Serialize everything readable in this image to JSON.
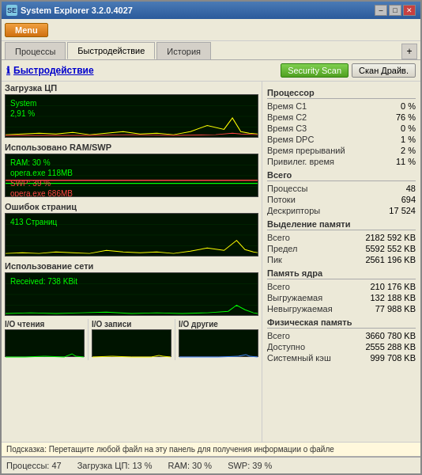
{
  "window": {
    "title": "System Explorer 3.2.0.4027",
    "min_btn": "–",
    "max_btn": "□",
    "close_btn": "✕"
  },
  "toolbar": {
    "menu_label": "Menu"
  },
  "tabs": [
    {
      "label": "Процессы",
      "active": false
    },
    {
      "label": "Быстродействие",
      "active": true
    },
    {
      "label": "История",
      "active": false
    }
  ],
  "page_title": "Быстродействие",
  "header_buttons": {
    "security_scan": "Security Scan",
    "scan_drive": "Скан Драйв."
  },
  "sections": {
    "cpu_load": "Загрузка ЦП",
    "ram_swp": "Использовано RAM/SWP",
    "page_faults": "Ошибок страниц",
    "network": "Использование сети"
  },
  "cpu_overlay": {
    "line1": "System",
    "line2": "2,91 %"
  },
  "ram_overlay": {
    "line1": "RAM: 30 %",
    "line2": "opera.exe 118MB",
    "line3": "SWP: 39 %",
    "line4": "opera.exe 686MB"
  },
  "pagefault_overlay": {
    "line1": "413 Страниц"
  },
  "network_overlay": {
    "line1": "Received: 738 KBit"
  },
  "io_sections": {
    "read": "I/O чтения",
    "write": "I/O записи",
    "other": "I/O другие"
  },
  "hint": "Подсказка: Перетащите любой файл на эту панель для получения информации о файле",
  "status_bar": {
    "processes": "Процессы: 47",
    "cpu": "Загрузка ЦП: 13 %",
    "ram": "RAM: 30 %",
    "swp": "SWP: 39 %"
  },
  "right_panel": {
    "processor": {
      "title": "Процессор",
      "rows": [
        {
          "label": "Время C1",
          "value": "0 %"
        },
        {
          "label": "Время C2",
          "value": "76 %"
        },
        {
          "label": "Время C3",
          "value": "0 %"
        },
        {
          "label": "Время DPC",
          "value": "1 %"
        },
        {
          "label": "Время прерываний",
          "value": "2 %"
        },
        {
          "label": "Привилег. время",
          "value": "11 %"
        }
      ]
    },
    "total": {
      "title": "Всего",
      "rows": [
        {
          "label": "Процессы",
          "value": "48"
        },
        {
          "label": "Потоки",
          "value": "694"
        },
        {
          "label": "Дескрипторы",
          "value": "17 524"
        }
      ]
    },
    "memory_alloc": {
      "title": "Выделение памяти",
      "rows": [
        {
          "label": "Всего",
          "value": "2182 592 KB"
        },
        {
          "label": "Предел",
          "value": "5592 552 KB"
        },
        {
          "label": "Пик",
          "value": "2561 196 KB"
        }
      ]
    },
    "kernel_memory": {
      "title": "Память ядра",
      "rows": [
        {
          "label": "Всего",
          "value": "210 176 KB"
        },
        {
          "label": "Выгружаемая",
          "value": "132 188 KB"
        },
        {
          "label": "Невыгружаемая",
          "value": "77 988 KB"
        }
      ]
    },
    "physical_memory": {
      "title": "Физическая память",
      "rows": [
        {
          "label": "Всего",
          "value": "3660 780 KB"
        },
        {
          "label": "Доступно",
          "value": "2555 288 KB"
        },
        {
          "label": "Системный кэш",
          "value": "999 708 KB"
        }
      ]
    }
  }
}
